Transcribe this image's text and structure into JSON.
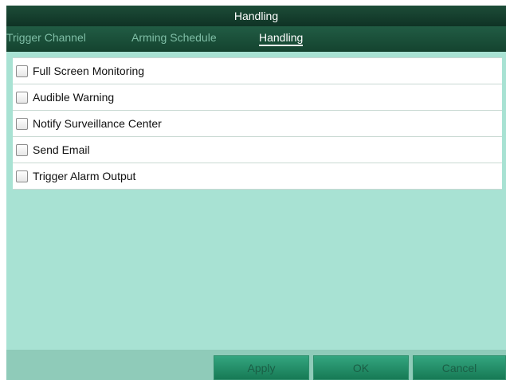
{
  "window": {
    "title": "Handling"
  },
  "tabs": [
    {
      "label": "Trigger Channel",
      "active": false
    },
    {
      "label": "Arming Schedule",
      "active": false
    },
    {
      "label": "Handling",
      "active": true
    }
  ],
  "options": [
    {
      "label": "Full Screen Monitoring",
      "checked": false
    },
    {
      "label": "Audible Warning",
      "checked": false
    },
    {
      "label": "Notify Surveillance Center",
      "checked": false
    },
    {
      "label": "Send Email",
      "checked": false
    },
    {
      "label": "Trigger Alarm Output",
      "checked": false
    }
  ],
  "buttons": {
    "apply": "Apply",
    "ok": "OK",
    "cancel": "Cancel"
  }
}
